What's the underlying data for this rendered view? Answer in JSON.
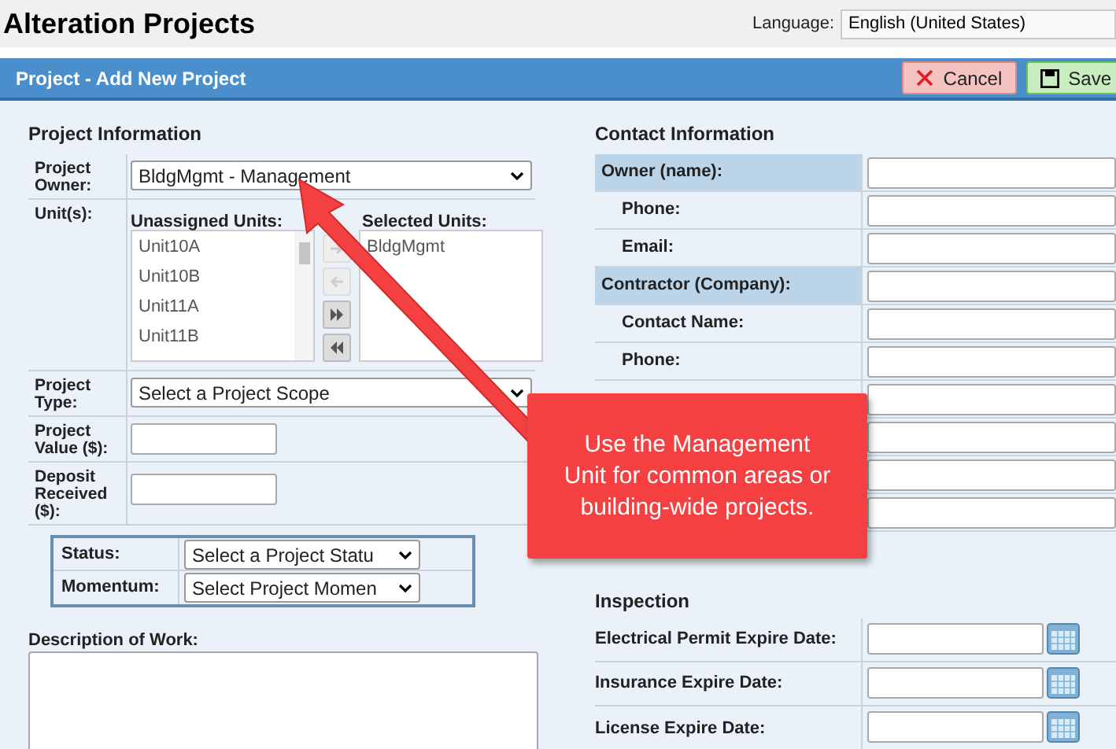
{
  "page_title": "Alteration Projects",
  "language": {
    "label": "Language:",
    "value": "English (United States)"
  },
  "panel": {
    "title": "Project - Add New Project",
    "buttons": [
      {
        "kind": "cancel",
        "label": "Cancel"
      },
      {
        "kind": "save",
        "label": "Save"
      }
    ]
  },
  "project_information": {
    "heading": "Project Information",
    "owner": {
      "label": "Project Owner:",
      "value": "BldgMgmt - Management"
    },
    "units": {
      "label": "Unit(s):",
      "unassigned_label": "Unassigned Units:",
      "unassigned": [
        "Unit10A",
        "Unit10B",
        "Unit11A",
        "Unit11B"
      ],
      "selected_label": "Selected Units:",
      "selected": [
        "BldgMgmt"
      ],
      "move_buttons": [
        {
          "kind": "right",
          "disabled": true
        },
        {
          "kind": "left",
          "disabled": true
        },
        {
          "kind": "all_right",
          "disabled": false
        },
        {
          "kind": "all_left",
          "disabled": false
        }
      ]
    },
    "type": {
      "label": "Project Type:",
      "value": "Select a Project Scope"
    },
    "value": {
      "label": "Project Value ($):"
    },
    "deposit": {
      "label": "Deposit Received ($):"
    },
    "status": {
      "label": "Status:",
      "value": "Select a Project Statu"
    },
    "momentum": {
      "label": "Momentum:",
      "value": "Select Project Momen"
    },
    "description": {
      "label": "Description of Work:"
    }
  },
  "contact_information": {
    "heading": "Contact Information",
    "rows": [
      {
        "label": "Owner (name):",
        "kind": "group"
      },
      {
        "label": "Phone:",
        "kind": "sub"
      },
      {
        "label": "Email:",
        "kind": "sub"
      },
      {
        "label": "Contractor (Company):",
        "kind": "group"
      },
      {
        "label": "Contact Name:",
        "kind": "sub"
      },
      {
        "label": "Phone:",
        "kind": "sub"
      },
      {
        "kind": "sub"
      },
      {
        "kind": "sub"
      },
      {
        "kind": "sub"
      },
      {
        "kind": "sub"
      }
    ]
  },
  "inspection": {
    "heading": "Inspection",
    "rows": [
      {
        "label": "Electrical Permit Expire Date:"
      },
      {
        "label": "Insurance Expire Date:"
      },
      {
        "label": "License Expire Date:"
      }
    ]
  },
  "callout": {
    "text": "Use the Management Unit for common areas or building-wide projects."
  }
}
